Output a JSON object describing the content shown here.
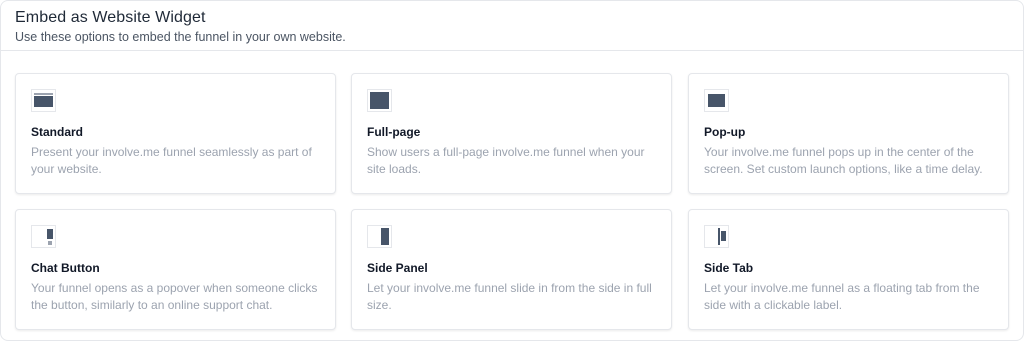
{
  "header": {
    "title": "Embed as Website Widget",
    "subtitle": "Use these options to embed the funnel in your own website."
  },
  "options": [
    {
      "icon": "standard-layout-icon",
      "title": "Standard",
      "description": "Present your involve.me funnel seamlessly as part of your website."
    },
    {
      "icon": "full-page-layout-icon",
      "title": "Full-page",
      "description": "Show users a full-page involve.me funnel when your site loads."
    },
    {
      "icon": "popup-layout-icon",
      "title": "Pop-up",
      "description": "Your involve.me funnel pops up in the center of the screen. Set custom launch options, like a time delay."
    },
    {
      "icon": "chat-button-layout-icon",
      "title": "Chat Button",
      "description": "Your funnel opens as a popover when someone clicks the button, similarly to an online support chat."
    },
    {
      "icon": "side-panel-layout-icon",
      "title": "Side Panel",
      "description": "Let your involve.me funnel slide in from the side in full size."
    },
    {
      "icon": "side-tab-layout-icon",
      "title": "Side Tab",
      "description": "Let your involve.me funnel as a floating tab from the side with a clickable label."
    }
  ],
  "colors": {
    "icon_fill": "#475569",
    "desc_text": "#9ca3af",
    "border": "#e5e7eb"
  }
}
